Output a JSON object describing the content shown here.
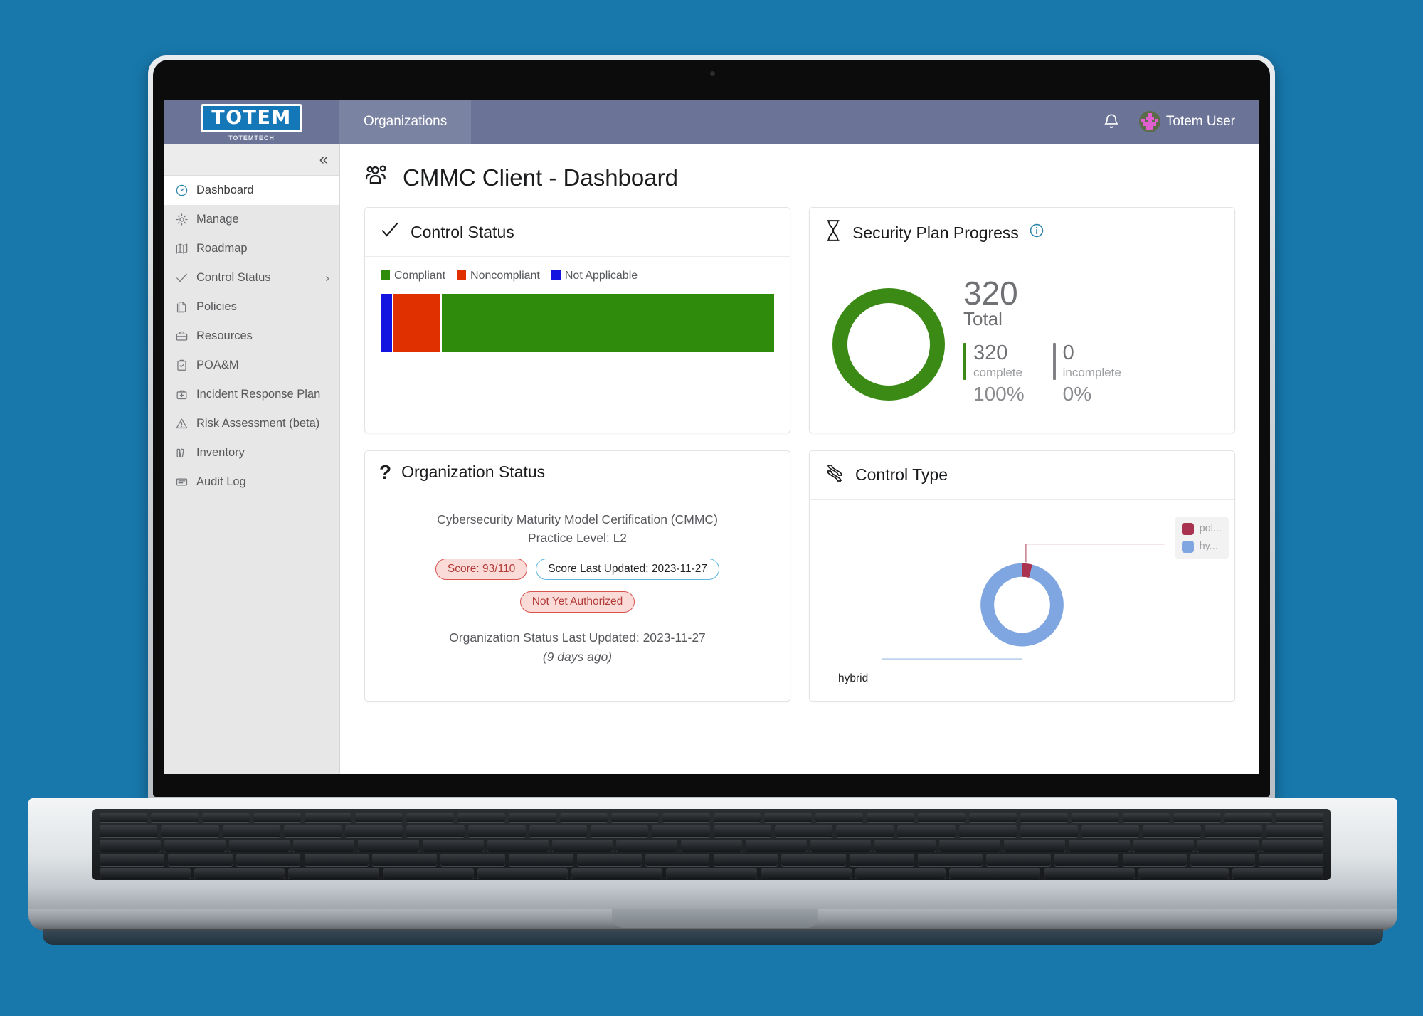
{
  "topbar": {
    "logo_text": "TOTEM",
    "logo_sub": "TOTEMTECH",
    "tab_label": "Organizations",
    "bell_icon": "bell-icon",
    "user_name": "Totem User"
  },
  "sidebar": {
    "collapse_label": "«",
    "items": [
      {
        "label": "Dashboard",
        "icon": "speedometer-icon",
        "active": true
      },
      {
        "label": "Manage",
        "icon": "gear-icon",
        "active": false
      },
      {
        "label": "Roadmap",
        "icon": "map-icon",
        "active": false
      },
      {
        "label": "Control Status",
        "icon": "check-icon",
        "active": false,
        "chevron": "›"
      },
      {
        "label": "Policies",
        "icon": "document-icon",
        "active": false
      },
      {
        "label": "Resources",
        "icon": "toolbox-icon",
        "active": false
      },
      {
        "label": "POA&M",
        "icon": "clipboard-check-icon",
        "active": false
      },
      {
        "label": "Incident Response Plan",
        "icon": "first-aid-kit-icon",
        "active": false
      },
      {
        "label": "Risk Assessment (beta)",
        "icon": "warning-triangle-icon",
        "active": false
      },
      {
        "label": "Inventory",
        "icon": "books-icon",
        "active": false
      },
      {
        "label": "Audit Log",
        "icon": "log-icon",
        "active": false
      }
    ]
  },
  "page": {
    "title": "CMMC Client - Dashboard",
    "title_icon": "users-group-icon"
  },
  "cards": {
    "control_status": {
      "title": "Control Status",
      "icon": "checkmark-icon"
    },
    "security_plan": {
      "title": "Security Plan Progress",
      "icon": "hourglass-icon",
      "info_icon": "info-circle-icon",
      "total_value": "320",
      "total_label": "Total",
      "complete_value": "320",
      "complete_label": "complete",
      "complete_pct": "100%",
      "incomplete_value": "0",
      "incomplete_label": "incomplete",
      "incomplete_pct": "0%",
      "complete_color": "#3a8a15",
      "incomplete_color": "#808285"
    },
    "organization_status": {
      "title": "Organization Status",
      "icon": "question-mark-icon",
      "framework": "Cybersecurity Maturity Model Certification (CMMC)",
      "practice_level": "Practice Level: L2",
      "score_badge": "Score: 93/110",
      "score_updated_badge": "Score Last Updated: 2023-11-27",
      "authorization_badge": "Not Yet Authorized",
      "last_updated": "Organization Status Last Updated: 2023-11-27",
      "ago": "(9 days ago)"
    },
    "control_type": {
      "title": "Control Type",
      "icon": "dna-helix-icon",
      "legend": [
        {
          "label": "pol...",
          "color": "#a8324f"
        },
        {
          "label": "hy...",
          "color": "#7fa6e0"
        }
      ],
      "callout_policy": "policy",
      "callout_hybrid": "hybrid"
    }
  },
  "chart_data": [
    {
      "type": "bar",
      "title": "Control Status",
      "orientation": "horizontal-stacked",
      "categories": [
        "Not Applicable",
        "Noncompliant",
        "Compliant"
      ],
      "series": [
        {
          "name": "Not Applicable",
          "value": 3,
          "color": "#1414e0"
        },
        {
          "name": "Noncompliant",
          "value": 12,
          "color": "#e03000"
        },
        {
          "name": "Compliant",
          "value": 85,
          "color": "#2e8b0b"
        }
      ],
      "values": [
        3,
        12,
        85
      ],
      "unit": "percent",
      "legend": [
        "Compliant",
        "Noncompliant",
        "Not Applicable"
      ],
      "legend_position": "top-left",
      "grid": false,
      "xlabel": "",
      "ylabel": ""
    },
    {
      "type": "pie",
      "title": "Security Plan Progress",
      "subtitle": "320 Total",
      "labels": [
        "complete",
        "incomplete"
      ],
      "values": [
        320,
        0
      ],
      "percents": [
        100,
        0
      ],
      "colors": [
        "#3a8a15",
        "#808285"
      ],
      "donut": true,
      "legend_position": "right"
    },
    {
      "type": "pie",
      "title": "Control Type",
      "labels": [
        "policy",
        "hybrid"
      ],
      "values": [
        4,
        96
      ],
      "percents": [
        4,
        96
      ],
      "colors": [
        "#a8324f",
        "#7fa6e0"
      ],
      "donut": true,
      "legend_position": "right",
      "annotations": [
        "policy",
        "hybrid"
      ]
    }
  ]
}
